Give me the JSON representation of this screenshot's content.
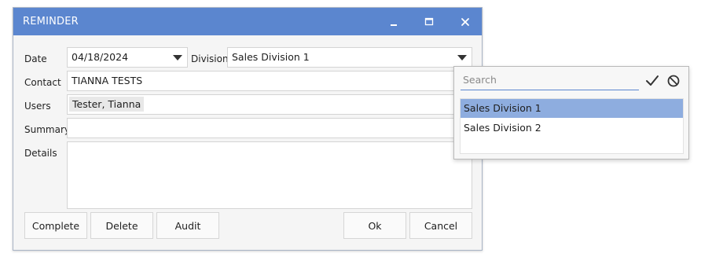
{
  "window": {
    "title": "REMINDER"
  },
  "form": {
    "date_label": "Date",
    "date_value": "04/18/2024",
    "division_label": "Division",
    "division_value": "Sales Division 1",
    "contact_label": "Contact",
    "contact_value": "TIANNA TESTS",
    "users_label": "Users",
    "users_chip": "Tester, Tianna",
    "summary_label": "Summary",
    "summary_value": "",
    "details_label": "Details",
    "details_value": ""
  },
  "buttons": {
    "complete": "Complete",
    "delete": "Delete",
    "audit": "Audit",
    "ok": "Ok",
    "cancel": "Cancel"
  },
  "division_dropdown": {
    "search_placeholder": "Search",
    "options": [
      {
        "label": "Sales Division 1",
        "selected": true
      },
      {
        "label": "Sales Division 2",
        "selected": false
      }
    ]
  },
  "icons": {
    "minimize": "minimize-icon",
    "maximize": "maximize-icon",
    "close": "close-icon",
    "confirm": "checkmark-icon",
    "clear": "cancel-circle-icon",
    "dropdown": "chevron-down-icon"
  },
  "colors": {
    "titlebar": "#5b86cf",
    "selected_option": "#8eaddf",
    "search_underline": "#5b86cf"
  }
}
